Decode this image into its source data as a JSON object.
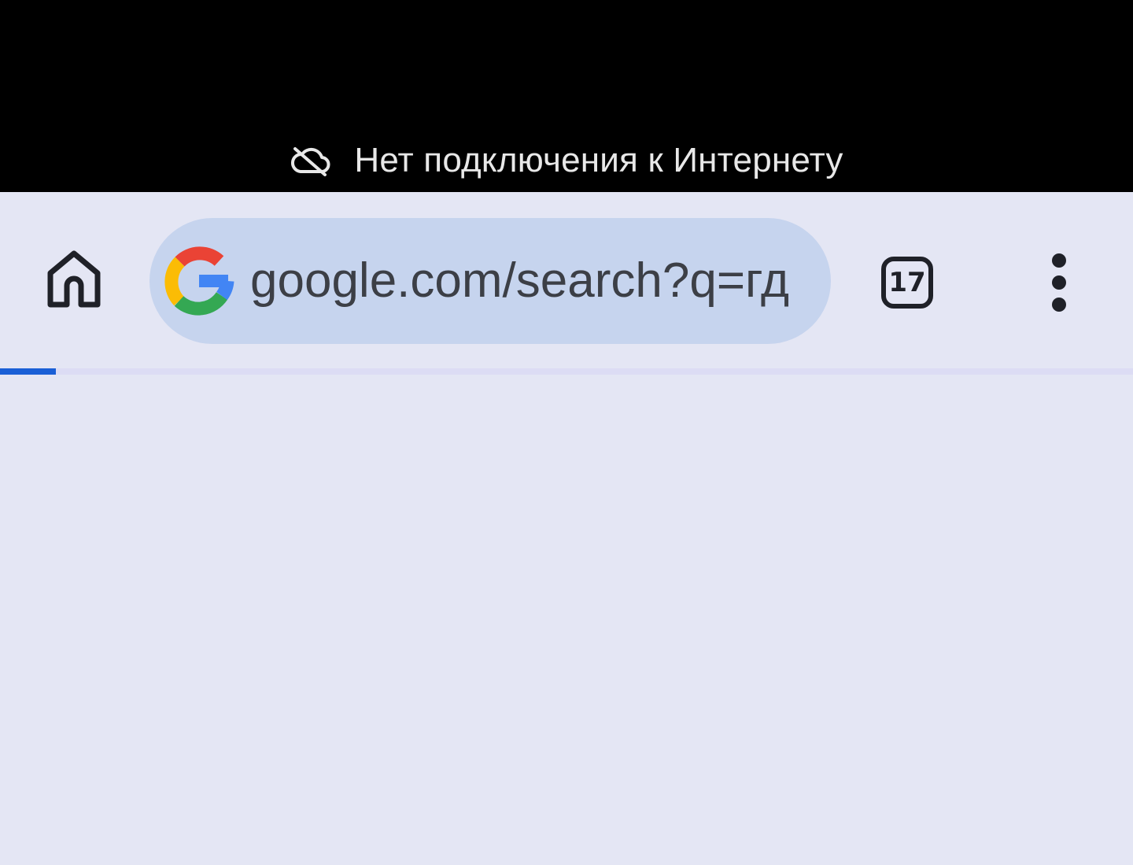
{
  "status_banner": {
    "icon": "cloud-off-icon",
    "text": "Нет подключения к Интернету"
  },
  "toolbar": {
    "home_icon": "home-icon",
    "omnibox": {
      "favicon": "google-g-icon",
      "url": "google.com/search?q=гд"
    },
    "tab_count": "17",
    "menu_icon": "more-vert-icon"
  },
  "progress": {
    "fraction": 0.049
  },
  "colors": {
    "banner_bg": "#000000",
    "toolbar_bg": "#e4e6f4",
    "omnibox_bg": "#c6d4ee",
    "progress_fill": "#1a5fd6",
    "icon": "#1f2128"
  }
}
